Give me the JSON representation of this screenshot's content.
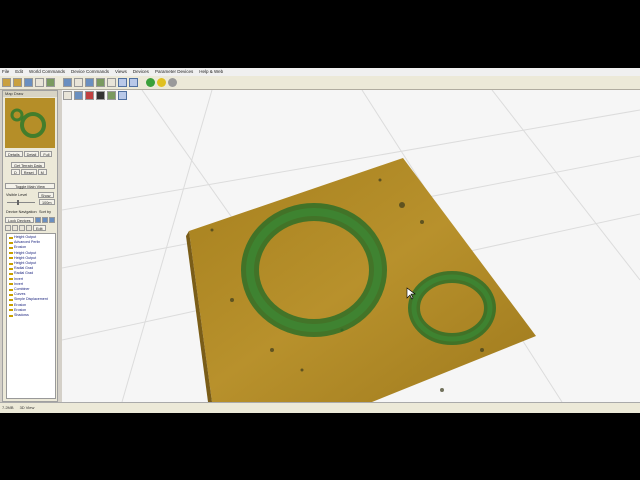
{
  "menu": [
    "File",
    "Edit",
    "World Commands",
    "Device Commands",
    "Views",
    "Devices",
    "Parameter Devices",
    "Help & Web"
  ],
  "sidebar": {
    "title": "Map Draw",
    "view_buttons": [
      "Details",
      "Detail",
      "Full"
    ],
    "get_terrain_btn": "Get Terrain Data",
    "small_btns": [
      "D",
      "Reset",
      "M"
    ],
    "toggle_btn": "Toggle Main View",
    "vis_label": "Visible Level",
    "show_btn": "Show",
    "scale_value": "100m",
    "device_nav_label": "Device Navigation",
    "sort_label": "Sort by",
    "lock_btn": "Lock Devices",
    "edit_btn": "Edit",
    "devices": [
      "Height Output",
      "Advanced Perlin",
      "Erosion",
      "Height Output",
      "Height Output",
      "Height Output",
      "Radial Grad",
      "Radial Grad",
      "Invert",
      "Invert",
      "Combiner",
      "Curves",
      "Simple Displacement",
      "Erosion",
      "Erosion",
      "Shadows"
    ]
  },
  "status": {
    "left": "7.2MB",
    "right": "3D View"
  },
  "colors": {
    "terrain": "#b58e28",
    "ring": "#2f7a2c"
  }
}
